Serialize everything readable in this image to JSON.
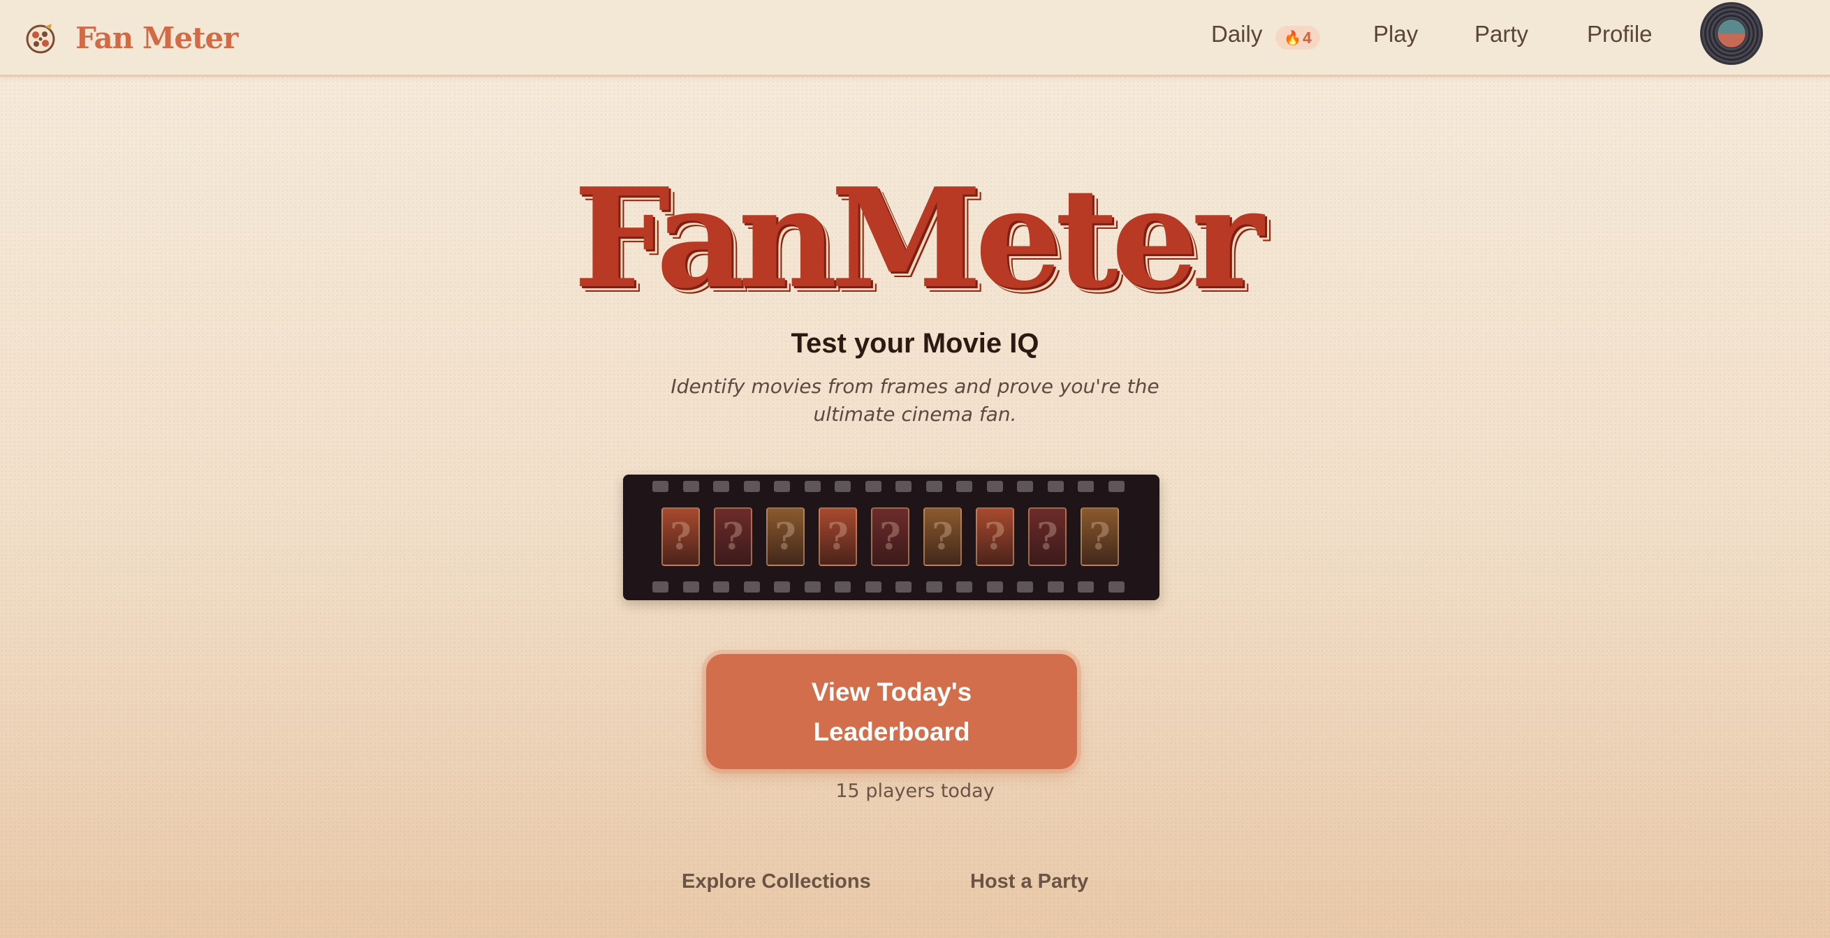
{
  "app": {
    "name": "Fan Meter",
    "logo_icon": "film-reel-icon"
  },
  "nav": {
    "daily_label": "Daily",
    "streak_icon": "flame-icon",
    "streak_count": "4",
    "play_label": "Play",
    "party_label": "Party",
    "profile_label": "Profile",
    "avatar_icon": "vinyl-record-avatar"
  },
  "hero": {
    "title": "FanMeter",
    "subtitle": "Test your Movie IQ",
    "description": "Identify movies from frames and prove you're the ultimate cinema fan."
  },
  "film_strip": {
    "frame_glyph": "?",
    "frame_colors": [
      "#a84a2e",
      "#6e2c2a",
      "#8a5a2e",
      "#a84a2e",
      "#6e2c2a",
      "#8a5a2e",
      "#a84a2e",
      "#6e2c2a",
      "#8a5a2e"
    ]
  },
  "cta": {
    "label": "View Today's Leaderboard",
    "players_text": "15 players today"
  },
  "footer_links": {
    "explore": "Explore Collections",
    "host": "Host a Party"
  },
  "colors": {
    "accent": "#d26e4b",
    "title_red": "#b83a24",
    "film_bg": "#1f1418"
  }
}
